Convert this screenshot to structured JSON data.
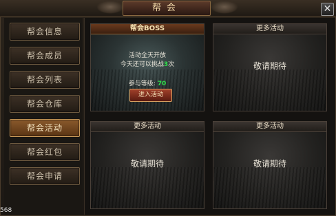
{
  "window": {
    "title": "帮会"
  },
  "sidebar": {
    "items": [
      {
        "label": "帮会信息"
      },
      {
        "label": "帮会成员"
      },
      {
        "label": "帮会列表"
      },
      {
        "label": "帮会仓库"
      },
      {
        "label": "帮会活动"
      },
      {
        "label": "帮会红包"
      },
      {
        "label": "帮会申请"
      }
    ],
    "active_index": 4
  },
  "panels": {
    "boss": {
      "title": "帮会BOSS",
      "line1": "活动全天开放",
      "line2_prefix": "今天还可以挑战",
      "remaining": "3",
      "line2_suffix": "次",
      "level_prefix": "参与等级:",
      "level_value": "70",
      "button_label": "进入活动"
    },
    "more1": {
      "title": "更多活动",
      "text": "敬请期待"
    },
    "more2": {
      "title": "更多活动",
      "text": "敬请期待"
    },
    "more3": {
      "title": "更多活动",
      "text": "敬请期待"
    }
  },
  "footer": {
    "corner_number": "568"
  },
  "colors": {
    "active_tab": "#8a5a2c",
    "highlight_green": "#2ee04a",
    "title_text": "#f2d9a8"
  }
}
